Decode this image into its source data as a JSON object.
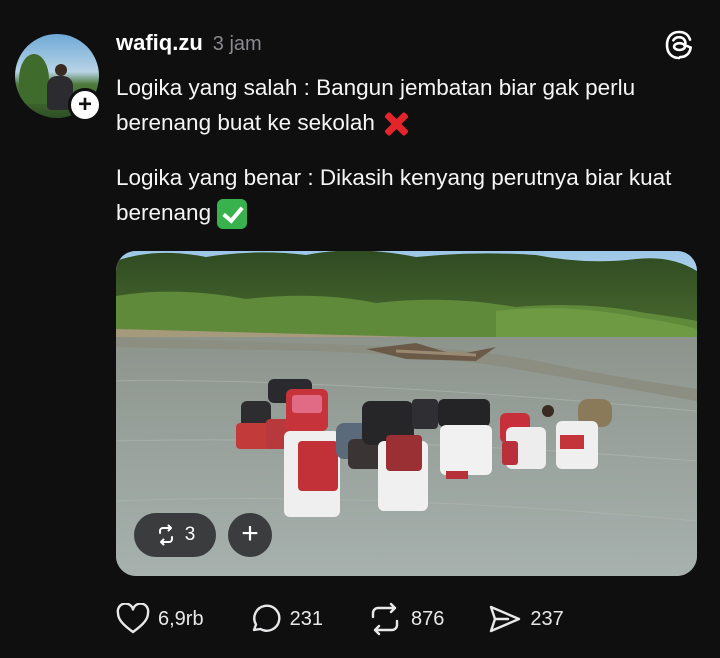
{
  "post": {
    "username": "wafiq.zu",
    "timestamp": "3 jam",
    "follow_label": "+",
    "paragraph_1": "Logika yang salah : Bangun jembatan biar gak perlu berenang buat ke sekolah",
    "paragraph_2": "Logika yang benar : Dikasih kenyang perutnya biar kuat berenang",
    "emoji_1": "cross-mark-emoji",
    "emoji_2": "check-mark-emoji"
  },
  "media": {
    "repost_count": "3",
    "add_label": "+"
  },
  "actions": {
    "likes": "6,9rb",
    "replies": "231",
    "reposts": "876",
    "shares": "237"
  },
  "colors": {
    "background": "#0f0f10",
    "text": "#f5f5f5",
    "muted": "#8a8a8f",
    "cross": "#e3252b",
    "check": "#37b24d"
  },
  "icons": [
    "threads-logo-icon",
    "heart-icon",
    "comment-icon",
    "repost-icon",
    "share-icon"
  ]
}
